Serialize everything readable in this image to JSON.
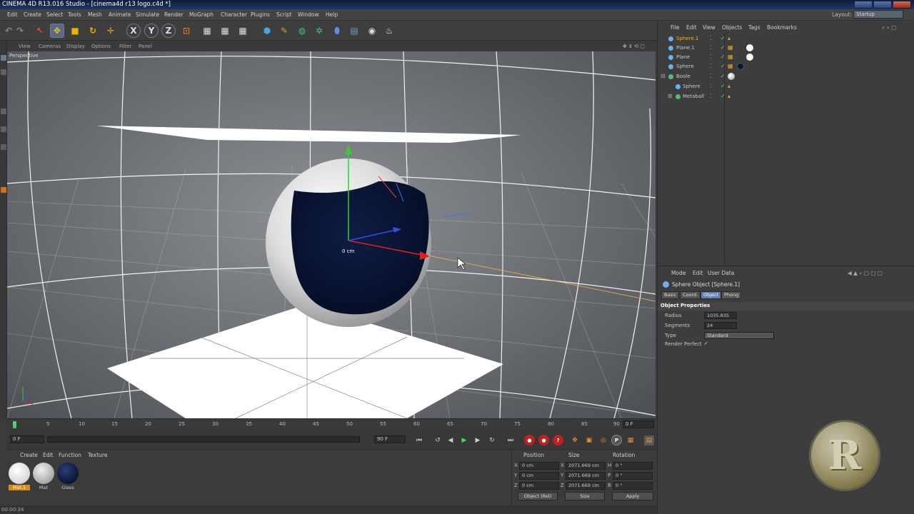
{
  "window": {
    "title": "CINEMA 4D R13.016 Studio - [cinema4d r13 logo.c4d *]"
  },
  "menubar": {
    "items": [
      "Edit",
      "Create",
      "Select",
      "Tools",
      "Mesh",
      "Animate",
      "Simulate",
      "Render",
      "MoGraph",
      "Character",
      "Plugins",
      "Script",
      "Window",
      "Help"
    ],
    "layout_label": "Layout:",
    "layout_value": "Startup"
  },
  "viewport": {
    "menu": [
      "View",
      "Cameras",
      "Display",
      "Options",
      "Filter",
      "Panel"
    ],
    "label": "Perspective",
    "readout": "0 cm"
  },
  "timeline": {
    "ticks": [
      "0",
      "5",
      "10",
      "15",
      "20",
      "25",
      "30",
      "35",
      "40",
      "45",
      "50",
      "55",
      "60",
      "65",
      "70",
      "75",
      "80",
      "85",
      "90"
    ],
    "current_frame": "0 F",
    "start_field": "0 F",
    "end_field": "90 F",
    "right_field": "0 F"
  },
  "transport": {
    "record_buttons": [
      "P"
    ]
  },
  "material_manager": {
    "menu": [
      "Create",
      "Edit",
      "Function",
      "Texture"
    ],
    "materials": [
      {
        "name": "Mat.1",
        "color": "#ffffff"
      },
      {
        "name": "Mat",
        "color": "#d8d8d8"
      },
      {
        "name": "Glass",
        "color": "#0a1633"
      }
    ]
  },
  "coordinates": {
    "headers": [
      "Position",
      "Size",
      "Rotation"
    ],
    "rows": [
      {
        "axis": "X",
        "pos": "0 cm",
        "size_axis": "X",
        "size": "2071.669 cm",
        "rot_axis": "H",
        "rot": "0 °"
      },
      {
        "axis": "Y",
        "pos": "0 cm",
        "size_axis": "Y",
        "size": "2071.669 cm",
        "rot_axis": "P",
        "rot": "0 °"
      },
      {
        "axis": "Z",
        "pos": "0 cm",
        "size_axis": "Z",
        "size": "2071.669 cm",
        "rot_axis": "B",
        "rot": "0 °"
      }
    ],
    "mode_dropdown": "Object (Rel)",
    "size_dropdown": "Size",
    "apply_label": "Apply"
  },
  "status": {
    "time": "00:00:34"
  },
  "object_manager": {
    "menu": [
      "File",
      "Edit",
      "View",
      "Objects",
      "Tags",
      "Bookmarks"
    ],
    "objects": [
      {
        "name": "Sphere.1",
        "color": "#ffb400",
        "selected": true,
        "tag": ""
      },
      {
        "name": "Plane.1",
        "color": "#c8c8c8",
        "selected": false,
        "tag": "#ffffff"
      },
      {
        "name": "Plane",
        "color": "#c8c8c8",
        "selected": false,
        "tag": "#ffffff"
      },
      {
        "name": "Sphere",
        "color": "#c8c8c8",
        "selected": false,
        "tag": "#0a1633"
      },
      {
        "name": "Boole",
        "color": "#c8c8c8",
        "selected": false,
        "tag": "#d8d8d8"
      },
      {
        "name": "Sphere",
        "color": "#c8c8c8",
        "selected": false,
        "tag": ""
      },
      {
        "name": "Metaball",
        "color": "#c8c8c8",
        "selected": false,
        "tag": ""
      }
    ]
  },
  "attribute_manager": {
    "menu": [
      "Mode",
      "Edit",
      "User Data"
    ],
    "object_title": "Sphere Object [Sphere.1]",
    "tabs": [
      "Basic",
      "Coord.",
      "Object",
      "Phong"
    ],
    "active_tab": "Object",
    "section_title": "Object Properties",
    "props": [
      {
        "label": "Radius",
        "value": "1035.835"
      },
      {
        "label": "Segments",
        "value": "24"
      },
      {
        "label": "Type",
        "value": "Standard"
      },
      {
        "label": "Render Perfect",
        "value": "✓"
      }
    ]
  },
  "watermark": {
    "logo": "R"
  }
}
